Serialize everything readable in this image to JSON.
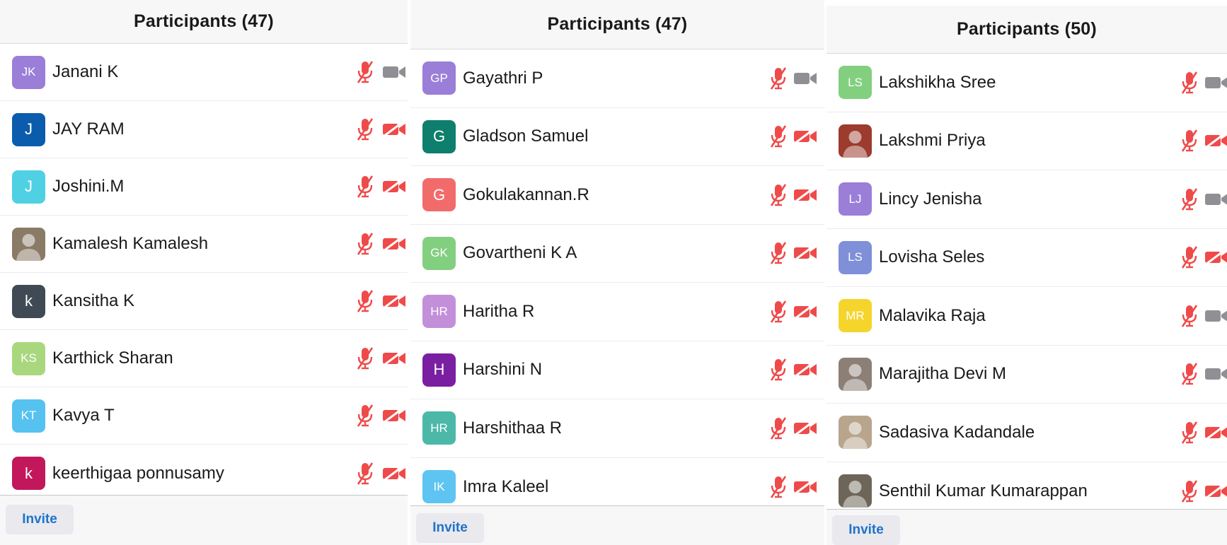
{
  "colors": {
    "muted_red": "#ef4a4a",
    "camera_gray": "#8f8f94",
    "invite_blue": "#1f73c9"
  },
  "icons": {
    "muted_mic": "mic-muted-icon",
    "video_off": "video-off-icon",
    "video_on": "video-icon"
  },
  "panels": [
    {
      "title": "Participants (47)",
      "invite_label": "Invite",
      "participants": [
        {
          "name": "Janani K",
          "initials": "JK",
          "avatar_color": "#9a7ed8",
          "photo": false,
          "video": "on"
        },
        {
          "name": "JAY RAM",
          "initials": "J",
          "avatar_color": "#0b5cad",
          "photo": false,
          "video": "off"
        },
        {
          "name": "Joshini.M",
          "initials": "J",
          "avatar_color": "#4fd0e3",
          "photo": false,
          "video": "off"
        },
        {
          "name": "Kamalesh Kamalesh",
          "initials": "",
          "avatar_color": "#8a7b66",
          "photo": true,
          "video": "off"
        },
        {
          "name": "Kansitha K",
          "initials": "k",
          "avatar_color": "#3f4a55",
          "photo": false,
          "video": "off"
        },
        {
          "name": "Karthick Sharan",
          "initials": "KS",
          "avatar_color": "#a9d77d",
          "photo": false,
          "video": "off"
        },
        {
          "name": "Kavya T",
          "initials": "KT",
          "avatar_color": "#56c2f0",
          "photo": false,
          "video": "off"
        },
        {
          "name": "keerthigaa ponnusamy",
          "initials": "k",
          "avatar_color": "#c2185b",
          "photo": false,
          "video": "off"
        }
      ]
    },
    {
      "title": "Participants (47)",
      "invite_label": "Invite",
      "participants": [
        {
          "name": "Gayathri P",
          "initials": "GP",
          "avatar_color": "#9a7ed8",
          "photo": false,
          "video": "on"
        },
        {
          "name": "Gladson Samuel",
          "initials": "G",
          "avatar_color": "#0d7f6c",
          "photo": false,
          "video": "off"
        },
        {
          "name": "Gokulakannan.R",
          "initials": "G",
          "avatar_color": "#f26b6b",
          "photo": false,
          "video": "off"
        },
        {
          "name": "Govartheni K A",
          "initials": "GK",
          "avatar_color": "#83cf80",
          "photo": false,
          "video": "off"
        },
        {
          "name": "Haritha R",
          "initials": "HR",
          "avatar_color": "#c38fd9",
          "photo": false,
          "video": "off"
        },
        {
          "name": "Harshini N",
          "initials": "H",
          "avatar_color": "#7a1fa2",
          "photo": false,
          "video": "off"
        },
        {
          "name": "Harshithaa R",
          "initials": "HR",
          "avatar_color": "#4cb8a8",
          "photo": false,
          "video": "off"
        },
        {
          "name": "Imra Kaleel",
          "initials": "IK",
          "avatar_color": "#5ec4f2",
          "photo": false,
          "video": "off"
        }
      ]
    },
    {
      "title": "Participants (50)",
      "invite_label": "Invite",
      "participants": [
        {
          "name": "Lakshikha Sree",
          "initials": "LS",
          "avatar_color": "#83cf80",
          "photo": false,
          "video": "on"
        },
        {
          "name": "Lakshmi Priya",
          "initials": "",
          "avatar_color": "#9c3b2e",
          "photo": true,
          "video": "off"
        },
        {
          "name": "Lincy Jenisha",
          "initials": "LJ",
          "avatar_color": "#9a7ed8",
          "photo": false,
          "video": "on"
        },
        {
          "name": "Lovisha Seles",
          "initials": "LS",
          "avatar_color": "#7f8fd8",
          "photo": false,
          "video": "off"
        },
        {
          "name": "Malavika Raja",
          "initials": "MR",
          "avatar_color": "#f5d42c",
          "photo": false,
          "video": "on"
        },
        {
          "name": "Marajitha Devi M",
          "initials": "",
          "avatar_color": "#8c7f75",
          "photo": true,
          "video": "on"
        },
        {
          "name": "Sadasiva Kadandale",
          "initials": "",
          "avatar_color": "#b8a58c",
          "photo": true,
          "video": "off"
        },
        {
          "name": "Senthil Kumar Kumarappan",
          "initials": "",
          "avatar_color": "#6d6658",
          "photo": true,
          "video": "off"
        }
      ]
    }
  ]
}
